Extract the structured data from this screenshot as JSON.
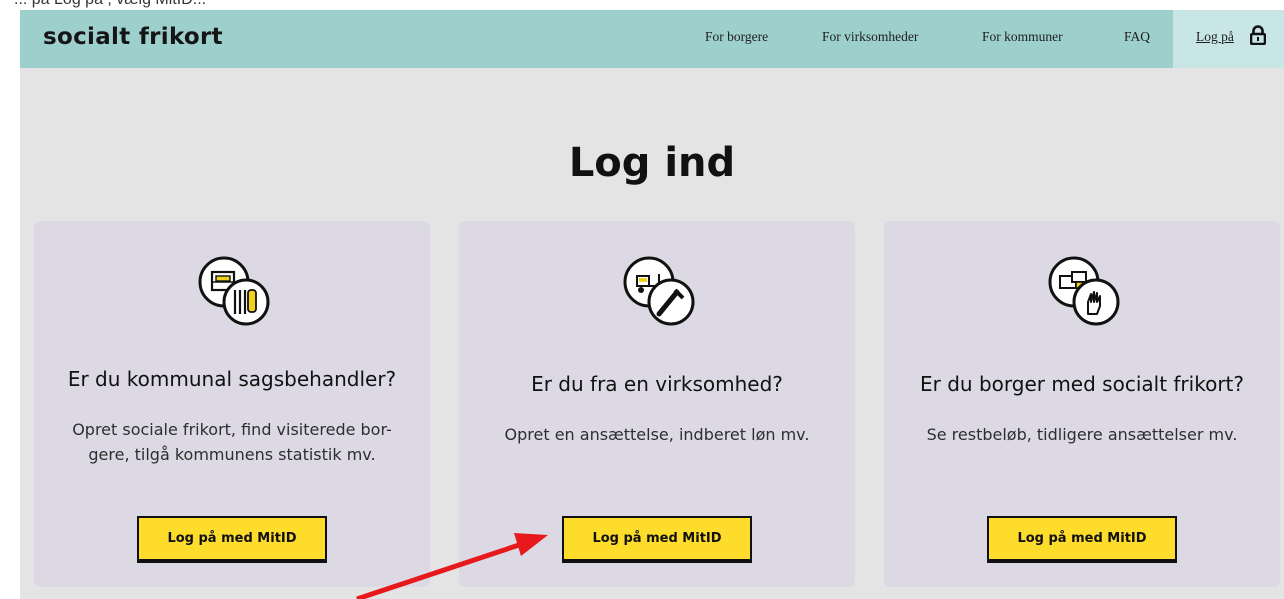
{
  "top_text": "... på Log på , vælg MitID...",
  "brand": {
    "logo": "socialt frikort"
  },
  "nav": {
    "items": [
      {
        "label": "For borgere"
      },
      {
        "label": "For virksomheder"
      },
      {
        "label": "For kommuner"
      },
      {
        "label": "FAQ"
      }
    ],
    "login_label": "Log på",
    "login_icon": "lock-icon"
  },
  "page": {
    "title": "Log ind"
  },
  "cards": [
    {
      "title": "Er du kommunal sagsbehandler?",
      "desc_lines": [
        "Opret sociale frikort, find visiterede bor-",
        "gere, tilgå kommunens statistik mv."
      ],
      "button": "Log på med MitID",
      "icon": "cabinet-and-binders-icon"
    },
    {
      "title": "Er du fra en virksomhed?",
      "desc_lines": [
        "Opret en ansættelse, indberet løn mv."
      ],
      "button": "Log på med MitID",
      "icon": "forklift-and-tool-icon"
    },
    {
      "title": "Er du borger med socialt frikort?",
      "desc_lines": [
        "Se restbeløb, tidligere ansættelser mv."
      ],
      "button": "Log på med MitID",
      "icon": "boxes-and-glove-icon"
    }
  ],
  "annotation": {
    "arrow_color": "#e8191d",
    "icon": "red-arrow-icon"
  },
  "colors": {
    "navbar": "#9dcfcd",
    "login_box": "#c7e6e5",
    "page_bg": "#e4e4e4",
    "card_bg": "#dcd9e4",
    "button_bg": "#fddc2c",
    "icon_accent": "#f2d11a"
  }
}
